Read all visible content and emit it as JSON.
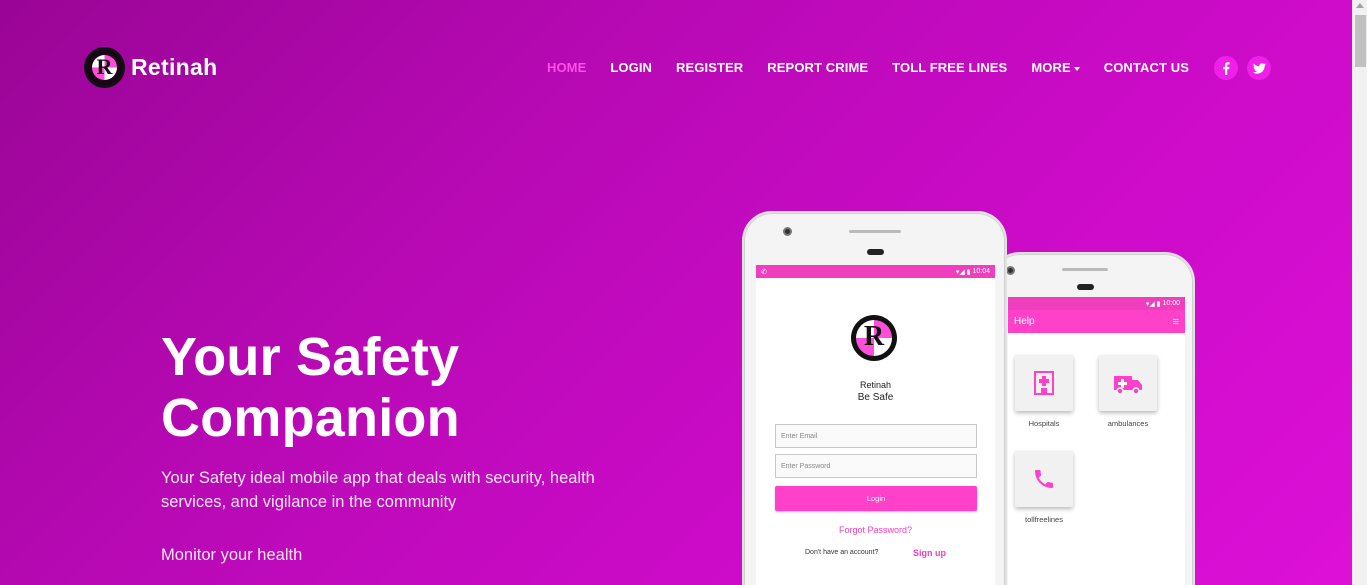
{
  "brand": {
    "name": "Retinah",
    "logo_letter": "R"
  },
  "nav": {
    "items": [
      {
        "label": "HOME",
        "active": true
      },
      {
        "label": "LOGIN"
      },
      {
        "label": "REGISTER"
      },
      {
        "label": "REPORT CRIME"
      },
      {
        "label": "TOLL FREE LINES"
      },
      {
        "label": "MORE"
      },
      {
        "label": "CONTACT US"
      }
    ],
    "active_color": "#ff4fe7"
  },
  "social": {
    "facebook": "f",
    "twitter": "t"
  },
  "hero": {
    "title_line1": "Your Safety",
    "title_line2": "Companion",
    "description": "Your Safety ideal mobile app that deals with security, health services, and vigilance in the community",
    "feature": "Monitor your health"
  },
  "phone_front": {
    "status_time": "10:04",
    "app_name": "Retinah",
    "tagline": "Be Safe",
    "email_placeholder": "Enter Email",
    "password_placeholder": "Enter Password",
    "login_label": "Login",
    "forgot_label": "Forgot Password?",
    "no_account_label": "Don't have an account?",
    "signup_label": "Sign up"
  },
  "phone_back": {
    "status_time": "10:00",
    "appbar_title": "Help",
    "tiles": [
      {
        "label": "Hospitals",
        "icon": "hospital-icon"
      },
      {
        "label": "ambulances",
        "icon": "ambulance-icon"
      },
      {
        "label": "tollfreelines",
        "icon": "phone-icon"
      }
    ]
  },
  "colors": {
    "accent": "#ff40c9",
    "background_start": "#9a0596",
    "background_end": "#dd10d8"
  }
}
